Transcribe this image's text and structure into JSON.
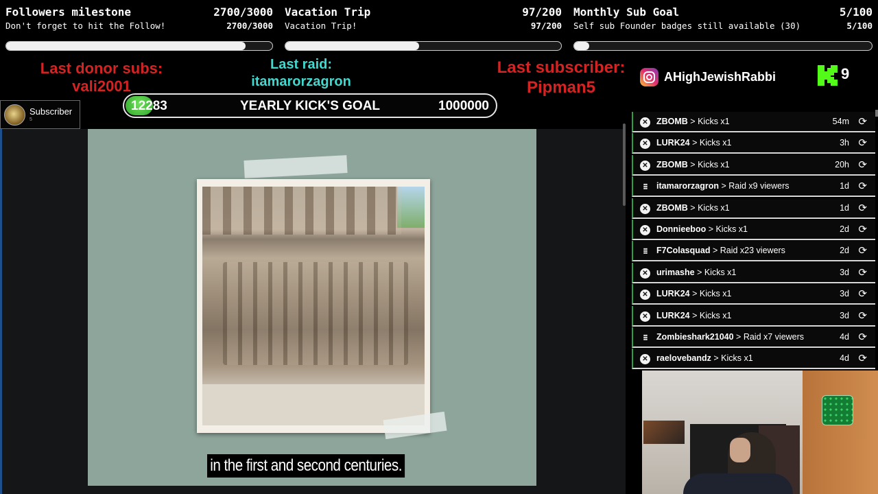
{
  "goals": [
    {
      "title": "Followers milestone",
      "count": "2700/3000",
      "subtitle": "Don't forget to hit the Follow!",
      "subcount": "2700/3000",
      "progress": 0.9
    },
    {
      "title": "Vacation Trip",
      "count": "97/200",
      "subtitle": "Vacation Trip!",
      "subcount": "97/200",
      "progress": 0.485
    },
    {
      "title": "Monthly Sub Goal",
      "count": "5/100",
      "subtitle": "Self sub Founder badges still available (30)",
      "subcount": "5/100",
      "progress": 0.05
    }
  ],
  "alerts": {
    "donor_label": "Last donor subs:",
    "donor_name": "vali2001",
    "raid_label": "Last raid:",
    "raid_name": "itamarorzagron",
    "subscriber_label": "Last subscriber:",
    "subscriber_name": "Pipman5"
  },
  "social": {
    "icon": "instagram-icon",
    "handle": "AHighJewishRabbi"
  },
  "kick": {
    "icon": "kick-logo-icon",
    "count": "9",
    "color": "#53fc18"
  },
  "yearly_goal": {
    "current": "12283",
    "label": "YEARLY KICK'S GOAL",
    "target": "1000000"
  },
  "subscriber_chip": {
    "label": "Subscriber",
    "count": "5"
  },
  "video": {
    "caption": "in the first and second centuries."
  },
  "events": [
    {
      "type": "kick",
      "user": "ZBOMB",
      "action": "Kicks x1",
      "time": "54m"
    },
    {
      "type": "kick",
      "user": "LURK24",
      "action": "Kicks x1",
      "time": "3h"
    },
    {
      "type": "kick",
      "user": "ZBOMB",
      "action": "Kicks x1",
      "time": "20h"
    },
    {
      "type": "raid",
      "user": "itamarorzagron",
      "action": "Raid x9 viewers",
      "time": "1d"
    },
    {
      "type": "kick",
      "user": "ZBOMB",
      "action": "Kicks x1",
      "time": "1d"
    },
    {
      "type": "kick",
      "user": "Donnieeboo",
      "action": "Kicks x1",
      "time": "2d"
    },
    {
      "type": "raid",
      "user": "F7Colasquad",
      "action": "Raid x23 viewers",
      "time": "2d"
    },
    {
      "type": "kick",
      "user": "urimashe",
      "action": "Kicks x1",
      "time": "3d"
    },
    {
      "type": "kick",
      "user": "LURK24",
      "action": "Kicks x1",
      "time": "3d"
    },
    {
      "type": "kick",
      "user": "LURK24",
      "action": "Kicks x1",
      "time": "3d"
    },
    {
      "type": "raid",
      "user": "Zombieshark21040",
      "action": "Raid x7 viewers",
      "time": "4d"
    },
    {
      "type": "kick",
      "user": "raelovebandz",
      "action": "Kicks x1",
      "time": "4d"
    }
  ],
  "colors": {
    "alert_red": "#d42323",
    "alert_cyan": "#3fd9cf",
    "event_accent": "#2ea043"
  }
}
